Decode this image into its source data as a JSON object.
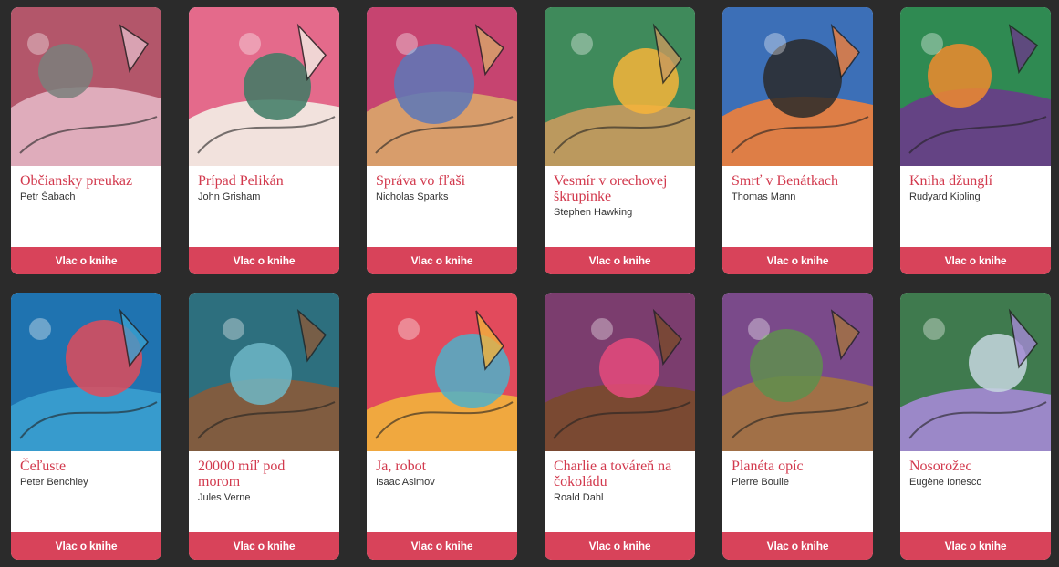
{
  "books": [
    {
      "title": "Občiansky preukaz",
      "author": "Petr Šabach",
      "button": "Vlac o knihe",
      "colors": [
        "#b3566a",
        "#e3b6c4",
        "#7a7f7b"
      ]
    },
    {
      "title": "Prípad Pelikán",
      "author": "John Grisham",
      "button": "Vlac o knihe",
      "colors": [
        "#e46a8b",
        "#f3efe6",
        "#3d7a64"
      ]
    },
    {
      "title": "Správa vo fľaši",
      "author": "Nicholas Sparks",
      "button": "Vlac o knihe",
      "colors": [
        "#c64470",
        "#d9a76a",
        "#5c78b8"
      ]
    },
    {
      "title": "Vesmír v orechovej škrupinke",
      "author": "Stephen Hawking",
      "button": "Vlac o knihe",
      "colors": [
        "#3f8a5b",
        "#c99a5e",
        "#f7b43a"
      ]
    },
    {
      "title": "Smrť v Benátkach",
      "author": "Thomas Mann",
      "button": "Vlac o knihe",
      "colors": [
        "#3c6fb7",
        "#f07f3a",
        "#2a2a2a"
      ]
    },
    {
      "title": "Kniha džunglí",
      "author": "Rudyard Kipling",
      "button": "Vlac o knihe",
      "colors": [
        "#2f8a52",
        "#6a3b8a",
        "#ef8a2e"
      ]
    },
    {
      "title": "Čeľuste",
      "author": "Peter Benchley",
      "button": "Vlac o knihe",
      "colors": [
        "#1f73b0",
        "#3aa0d0",
        "#e04b5b"
      ]
    },
    {
      "title": "20000 míľ pod morom",
      "author": "Jules Verne",
      "button": "Vlac o knihe",
      "colors": [
        "#2d6f7e",
        "#8a5a3a",
        "#6fb7c7"
      ]
    },
    {
      "title": "Ja, robot",
      "author": "Isaac Asimov",
      "button": "Vlac o knihe",
      "colors": [
        "#e24a5c",
        "#f2b23c",
        "#4db0c9"
      ]
    },
    {
      "title": "Charlie a továreň na čokoládu",
      "author": "Roald Dahl",
      "button": "Vlac o knihe",
      "colors": [
        "#7b3d6e",
        "#7a4a2b",
        "#e64a7d"
      ]
    },
    {
      "title": "Planéta opíc",
      "author": "Pierre Boulle",
      "button": "Vlac o knihe",
      "colors": [
        "#7a4a8a",
        "#a5743f",
        "#5f8e4e"
      ]
    },
    {
      "title": "Nosorožec",
      "author": "Eugène Ionesco",
      "button": "Vlac o knihe",
      "colors": [
        "#3f7a4e",
        "#a58ad6",
        "#c7d7e0"
      ]
    }
  ]
}
